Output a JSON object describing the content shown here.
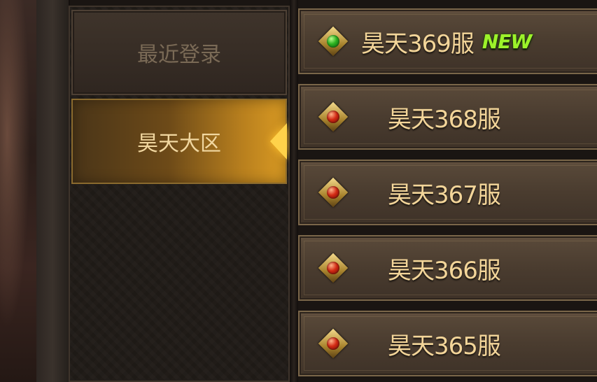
{
  "tabs": {
    "recent_label": "最近登录",
    "region_label": "昊天大区"
  },
  "servers": [
    {
      "name": "昊天369服",
      "badge": "NEW",
      "status": "green"
    },
    {
      "name": "昊天368服",
      "badge": "",
      "status": "red"
    },
    {
      "name": "昊天367服",
      "badge": "",
      "status": "red"
    },
    {
      "name": "昊天366服",
      "badge": "",
      "status": "red"
    },
    {
      "name": "昊天365服",
      "badge": "",
      "status": "red"
    }
  ],
  "colors": {
    "status_new": "#2bb21f",
    "status_busy": "#d32a14",
    "badge_new": "#9cf22a",
    "server_text": "#f3d599"
  }
}
